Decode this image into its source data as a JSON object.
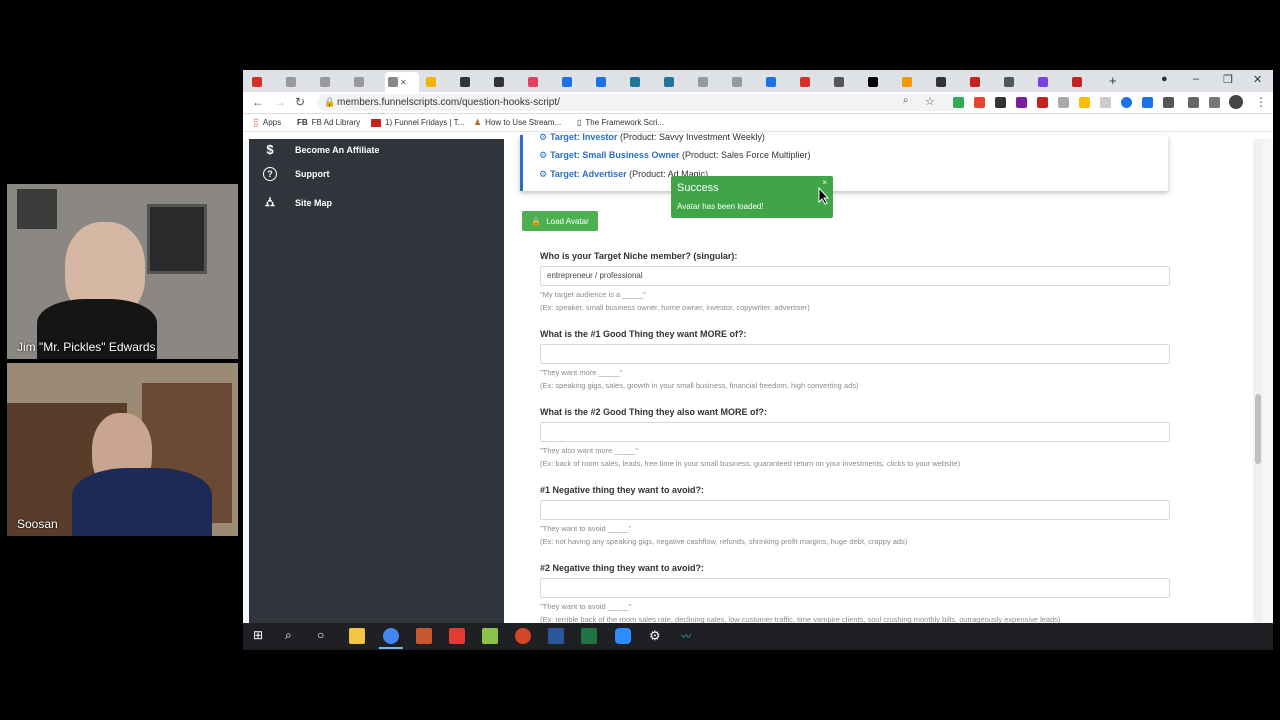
{
  "webcams": [
    {
      "name": "Jim \"Mr. Pickles\" Edwards"
    },
    {
      "name": "Soosan"
    }
  ],
  "browser": {
    "url": "members.funnelscripts.com/question-hooks-script/",
    "bookmarks": [
      {
        "label": "Apps",
        "icon": "apps-grid-icon"
      },
      {
        "label": "FB Ad Library",
        "icon": "fb-icon"
      },
      {
        "label": "1) Funnel Fridays | T...",
        "icon": "video-icon"
      },
      {
        "label": "How to Use Stream...",
        "icon": "person-icon"
      },
      {
        "label": "The Framework Scri...",
        "icon": "doc-icon"
      }
    ]
  },
  "sidebar": {
    "items": [
      {
        "label": "Become An Affiliate",
        "icon": "dollar-icon"
      },
      {
        "label": "Support",
        "icon": "question-circle-icon"
      },
      {
        "label": "Site Map",
        "icon": "sitemap-icon"
      }
    ]
  },
  "avatars": [
    {
      "target": "Target: Investor",
      "product": "(Product: Savvy Investment Weekly)"
    },
    {
      "target": "Target: Small Business Owner",
      "product": "(Product: Sales Force Multiplier)"
    },
    {
      "target": "Target: Advertiser",
      "product": "(Product: Ad Magic)"
    }
  ],
  "load_avatar_label": "Load Avatar",
  "toast": {
    "title": "Success",
    "message": "Avatar has been loaded!",
    "close": "×"
  },
  "fields": [
    {
      "label": "Who is your Target Niche member? (singular):",
      "value": "entrepreneur / professional",
      "hint1": "\"My target audience is a _____\"",
      "hint2": "(Ex: speaker, small business owner, home owner, investor, copywriter, advertiser)"
    },
    {
      "label": "What is the #1 Good Thing they want MORE of?:",
      "value": "",
      "hint1": "\"They want more _____\"",
      "hint2": "(Ex: speaking gigs, sales, growth in your small business, financial freedom, high converting ads)"
    },
    {
      "label": "What is the #2 Good Thing they also want MORE of?:",
      "value": "",
      "hint1": "\"They also want more _____\"",
      "hint2": "(Ex: back of room sales, leads, free time in your small business, guaranteed return on your investments, clicks to your website)"
    },
    {
      "label": "#1 Negative thing they want to avoid?:",
      "value": "",
      "hint1": "\"They want to avoid _____\"",
      "hint2": "(Ex: not having any speaking gigs, negative cashflow, refunds, shrinking profit margins, huge debt, crappy ads)"
    },
    {
      "label": "#2 Negative thing they want to avoid?:",
      "value": "",
      "hint1": "\"They want to avoid _____\"",
      "hint2": "(Ex: terrible back of the room sales rate, declining sales, low customer traffic, time vampire clients, soul crushing monthly bills, outrageously expensive leads)"
    }
  ]
}
